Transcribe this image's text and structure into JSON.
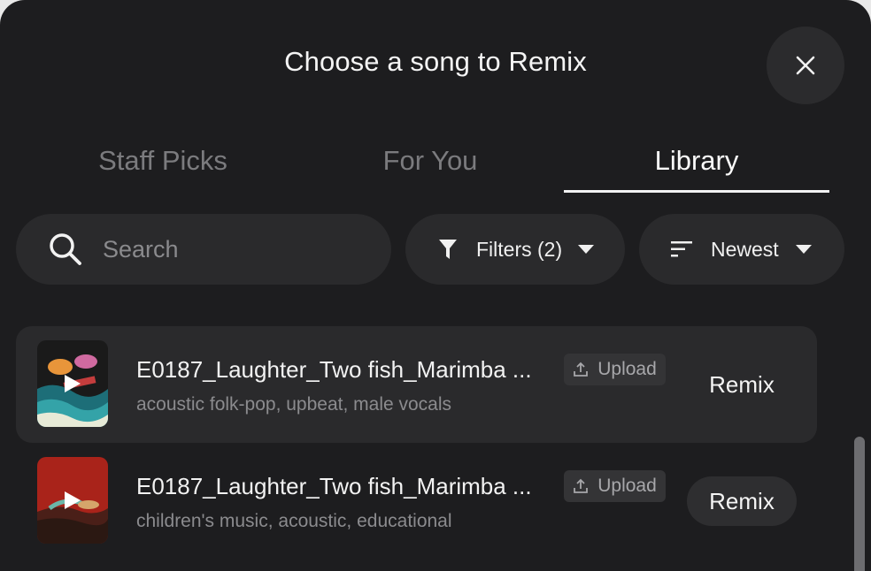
{
  "dialog": {
    "title": "Choose a song to Remix",
    "close_icon": "close-icon"
  },
  "tabs": [
    {
      "label": "Staff Picks",
      "active": false
    },
    {
      "label": "For You",
      "active": false
    },
    {
      "label": "Library",
      "active": true
    }
  ],
  "search": {
    "placeholder": "Search",
    "value": "",
    "icon": "search-icon"
  },
  "filters": {
    "label": "Filters (2)",
    "icon": "filter-icon"
  },
  "sort": {
    "label": "Newest",
    "icon": "sort-icon"
  },
  "songs": [
    {
      "title": "E0187_Laughter_Two fish_Marimba ...",
      "tags": "acoustic folk-pop, upbeat, male vocals",
      "badge": "Upload",
      "action": "Remix"
    },
    {
      "title": "E0187_Laughter_Two fish_Marimba ...",
      "tags": "children's music, acoustic, educational",
      "badge": "Upload",
      "action": "Remix"
    }
  ],
  "colors": {
    "background": "#1d1d1f",
    "surface": "#2a2a2c",
    "text": "#f2f2f2",
    "muted": "#8b8b8e"
  }
}
